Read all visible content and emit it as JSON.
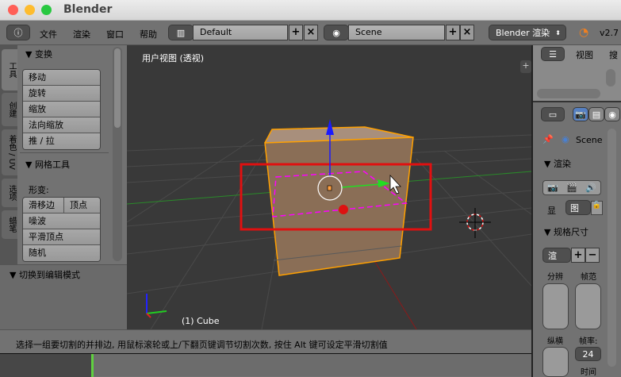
{
  "window": {
    "title": "Blender",
    "traffic_lights": [
      "#ff5f57",
      "#febc2e",
      "#28c840"
    ]
  },
  "header": {
    "menus": [
      "文件",
      "渲染",
      "窗口",
      "帮助"
    ],
    "layout": "Default",
    "scene": "Scene",
    "engine": "Blender 渲染",
    "version": "v2.7"
  },
  "tool_tabs": [
    "工具",
    "创建",
    "着色 / UV",
    "选项",
    "蜡笔"
  ],
  "tool_panel": {
    "transform": {
      "title": "变换",
      "buttons": [
        "移动",
        "旋转",
        "缩放",
        "法向缩放",
        "推 / 拉"
      ]
    },
    "mesh_tools": {
      "title": "网格工具",
      "deform_label": "形变:",
      "row": [
        "滑移边",
        "顶点"
      ],
      "buttons": [
        "噪波",
        "平滑顶点",
        "随机"
      ]
    },
    "operator_title": "切换到编辑模式"
  },
  "viewport": {
    "view_label": "用户视图 (透视)",
    "object_label": "(1) Cube",
    "axes": [
      "x",
      "y",
      "z"
    ],
    "highlight_color": "#e01010",
    "loop_color": "#ff00ff",
    "selection_color": "#ffa000"
  },
  "outliner": {
    "view_menu": "视图",
    "search_menu": "搜"
  },
  "properties": {
    "scene": "Scene",
    "render_title": "渲染",
    "display_label": "显",
    "display_value": "图",
    "dimensions_title": "规格尺寸",
    "preset": "渲",
    "resolution_label": "分辨",
    "frame_range_label": "帧范",
    "aspect_label": "纵横",
    "frame_rate_label": "帧率:",
    "frame_rate": "24",
    "time_label": "时间"
  },
  "status": {
    "text": "选择一组要切割的并排边, 用鼠标滚轮或上/下翻页键调节切割次数, 按住 Alt 键可设定平滑切割值"
  }
}
